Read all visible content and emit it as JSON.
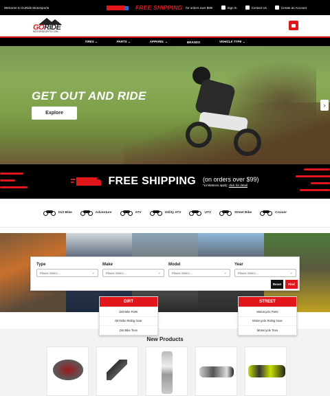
{
  "topbar": {
    "welcome": "Welcome to GoRide Motorsports",
    "free_shipping": "FREE SHIPPING",
    "on_orders": "for orders over $99!",
    "sign_in": "Sign In",
    "contact": "Contact Us",
    "create_account": "Create an Account"
  },
  "logo": {
    "go": "GO",
    "ride": "RIDE",
    "sub": "MOTORSPORTS.COM"
  },
  "nav": {
    "items": [
      "TIRES ⌄",
      "PARTS ⌄",
      "APPAREL ⌄",
      "BRANDS",
      "VEHICLE TYPE ⌄"
    ]
  },
  "hero": {
    "headline": "GET OUT AND RIDE",
    "button": "Explore",
    "next": "›"
  },
  "banner": {
    "title": "FREE SHIPPING",
    "sub": "(on orders over $99)",
    "note": "*Limitations apply;",
    "link": "click for detail"
  },
  "categories": [
    "Dirt Bike",
    "Adventure",
    "ATV",
    "Utility ATV",
    "UTV",
    "Street Bike",
    "Cruiser"
  ],
  "finder": {
    "fields": [
      {
        "label": "Type",
        "placeholder": "Please Select ..."
      },
      {
        "label": "Make",
        "placeholder": "Please Select ..."
      },
      {
        "label": "Model",
        "placeholder": "Please Select ..."
      },
      {
        "label": "Year",
        "placeholder": "Please Select ..."
      }
    ],
    "reset": "Reset",
    "find": "Find"
  },
  "dirt_menu": {
    "title": "DIRT",
    "items": [
      "Dirt Bike Parts",
      "Dirt Bike Riding Gear",
      "Dirt Bike Tires"
    ]
  },
  "street_menu": {
    "title": "STREET",
    "items": [
      "Motorcycle Parts",
      "Motorcycle Riding Gear",
      "Motorcycle Tires"
    ]
  },
  "new_products": {
    "title": "New Products"
  },
  "colors": {
    "accent": "#e3161b",
    "dark": "#000000"
  }
}
